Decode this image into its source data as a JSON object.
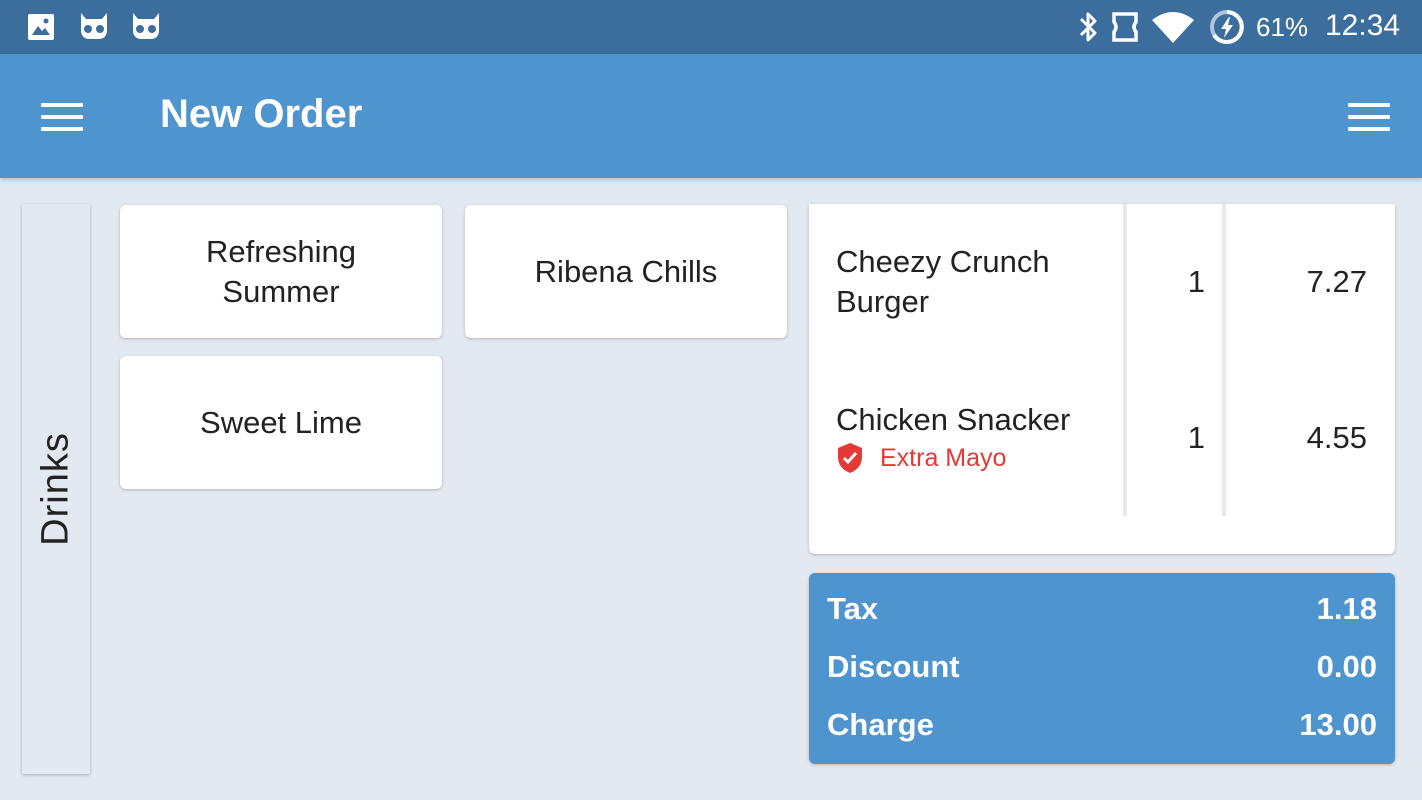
{
  "status_bar": {
    "battery": "61%",
    "time": "12:34",
    "icons": [
      "image-icon",
      "app-notification-icon",
      "app-notification-icon",
      "bluetooth-icon",
      "nfc-icon",
      "wifi-icon",
      "battery-charging-icon"
    ]
  },
  "app_bar": {
    "title": "New Order"
  },
  "category": {
    "label": "Drinks"
  },
  "products": [
    {
      "label": "Refreshing Summer"
    },
    {
      "label": "Ribena Chills"
    },
    {
      "label": "Sweet Lime"
    }
  ],
  "order": {
    "items": [
      {
        "name": "Cheezy Crunch Burger",
        "qty": "1",
        "price": "7.27",
        "modifier": ""
      },
      {
        "name": "Chicken Snacker",
        "qty": "1",
        "price": "4.55",
        "modifier": "Extra Mayo"
      }
    ]
  },
  "totals": {
    "tax_label": "Tax",
    "tax_value": "1.18",
    "discount_label": "Discount",
    "discount_value": "0.00",
    "charge_label": "Charge",
    "charge_value": "13.00"
  },
  "colors": {
    "status_bar": "#3b6e9c",
    "app_bar": "#4e94cf",
    "background": "#e3e9f0",
    "modifier": "#e53935"
  }
}
